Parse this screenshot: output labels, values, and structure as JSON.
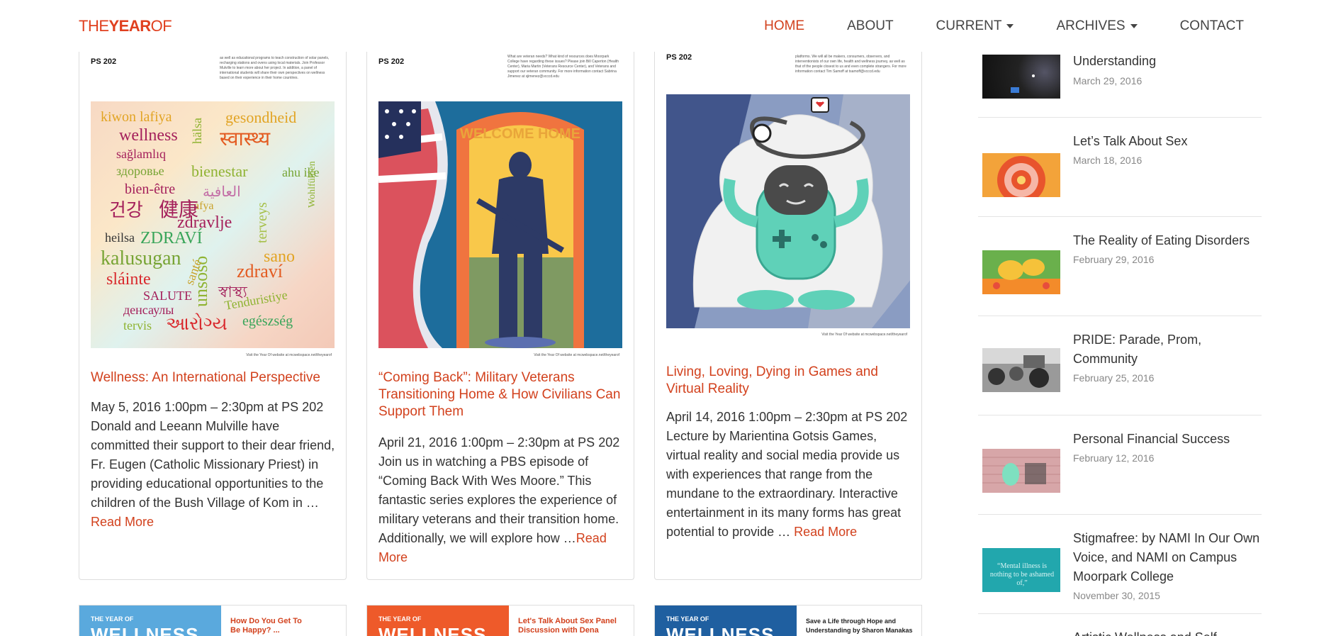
{
  "header": {
    "logo_thin": "THE",
    "logo_bold": "YEAR",
    "logo_thin2": "OF",
    "nav": [
      {
        "label": "HOME",
        "active": true,
        "dropdown": false
      },
      {
        "label": "ABOUT",
        "active": false,
        "dropdown": false
      },
      {
        "label": "CURRENT",
        "active": false,
        "dropdown": true
      },
      {
        "label": "ARCHIVES",
        "active": false,
        "dropdown": true
      },
      {
        "label": "CONTACT",
        "active": false,
        "dropdown": false
      }
    ]
  },
  "posts": [
    {
      "poster_room": "PS 202",
      "poster_footer": "Visit the Year Of website at mcwebspace.net/theyearof",
      "title": "Wellness: An International Perspective",
      "excerpt": "May 5, 2016 1:00pm – 2:30pm at PS 202 Donald and Leeann Mulville have committed their support to their dear friend, Fr. Eugen (Catholic Missionary Priest) in providing educational opportunities to the children of the Bush Village of Kom in … ",
      "read_more": "Read More",
      "poster_fine": "as well as educational programs to teach construction of solar panels, recharging stations and ovens using local materials. Join Professor Mulville to learn more about her project. In addition, a panel of international students will share their own perspectives on wellness based on their experience in their home countries.",
      "words": [
        "kiwon lafiya",
        "gesondheid",
        "wellness",
        "स्वास्थ्य",
        "sağlamlıq",
        "hälsa",
        "здоровье",
        "bienestar",
        "ahu ike",
        "bien-être",
        "العافية",
        "afya",
        "건강",
        "健康",
        "zdravlje",
        "heilsa",
        "ZDRAVÍ",
        "terveys",
        "sano",
        "kalusugan",
        "zdraví",
        "sláinte",
        "SALUTE",
        "স্বাস্থ্য",
        "денсаулы",
        "Tenduristiye",
        "tervis",
        "આરોગ્ય",
        "egészség",
        "unsoso",
        "santé",
        "Wohlfühlen"
      ]
    },
    {
      "poster_room": "PS 202",
      "poster_footer": "Visit the Year Of website at mcwebspace.net/theyearof",
      "poster_fine": "What are veteran needs? What kind of resources does Moorpark College have regarding these issues? Please join Bill Caperton (Health Center), Maria Martin (Veterans Resource Center), and Veterans and support our veteran community. For more information contact Sabrina Jimenez at sjimenez@vcccd.edu",
      "poster_banner": "WELCOME HOME",
      "title": "“Coming Back”: Military Veterans Transitioning Home & How Civilians Can Support Them",
      "excerpt": "April 21, 2016 1:00pm – 2:30pm at PS 202 Join us in watching a PBS episode of “Coming Back With Wes Moore.” This fantastic series explores the experience of military veterans and their transition home. Additionally, we will explore how …",
      "read_more": "Read More"
    },
    {
      "poster_room": "PS 202",
      "poster_footer": "Visit the Year Of website at mcwebspace.net/theyearof",
      "poster_fine": "platforms. We will all be makers, consumers, observers, and interventionists of our own life, health and wellness journey, as well as that of the people closest to us and even complete strangers. For more information contact Tim Samoff at tsamoff@vcccd.edu",
      "title": "Living, Loving, Dying in Games and Virtual Reality",
      "excerpt": "April 14, 2016 1:00pm – 2:30pm at PS 202 Lecture by Marientina Gotsis Games, virtual reality and social media provide us with experiences that range from the mundane to the extraordinary. Interactive entertainment in its many forms has great potential to provide … ",
      "read_more": "Read More"
    }
  ],
  "bottom_cards": [
    {
      "band_small": "THE YEAR OF",
      "band_large": "WELLNESS",
      "band_color": "#5aa9dd",
      "text": "How Do You Get To Be Happy? ...",
      "text_color": "#d2411d"
    },
    {
      "band_small": "THE YEAR OF",
      "band_large": "WELLNESS",
      "band_color": "#ee5a2a",
      "text": "Let's Talk About Sex Panel Discussion with Dena Stevens,",
      "text_color": "#d2411d"
    },
    {
      "band_small": "THE YEAR OF",
      "band_large": "WELLNESS",
      "band_color": "#1f5fa0",
      "text": "Save a Life through Hope and Understanding by Sharon Manakas",
      "text_color": "#222"
    }
  ],
  "sidebar": [
    {
      "title": "Understanding",
      "date": "March 29, 2016",
      "thumb": "dark"
    },
    {
      "title": "Let’s Talk About Sex",
      "date": "March 18, 2016",
      "thumb": "orange"
    },
    {
      "title": "The Reality of Eating Disorders",
      "date": "February 29, 2016",
      "thumb": "green"
    },
    {
      "title": "PRIDE: Parade, Prom, Community",
      "date": "February 25, 2016",
      "thumb": "bw"
    },
    {
      "title": "Personal Financial Success",
      "date": "February 12, 2016",
      "thumb": "pink"
    },
    {
      "title": "Stigmafree: by NAMI In Our Own Voice, and NAMI on Campus Moorpark College",
      "date": "November 30, 2015",
      "thumb": "teal",
      "thumb_text": "“Mental illness is nothing to be ashamed of,”"
    },
    {
      "title": "Artistic Wellness and Self",
      "date": "",
      "thumb": "none"
    }
  ]
}
